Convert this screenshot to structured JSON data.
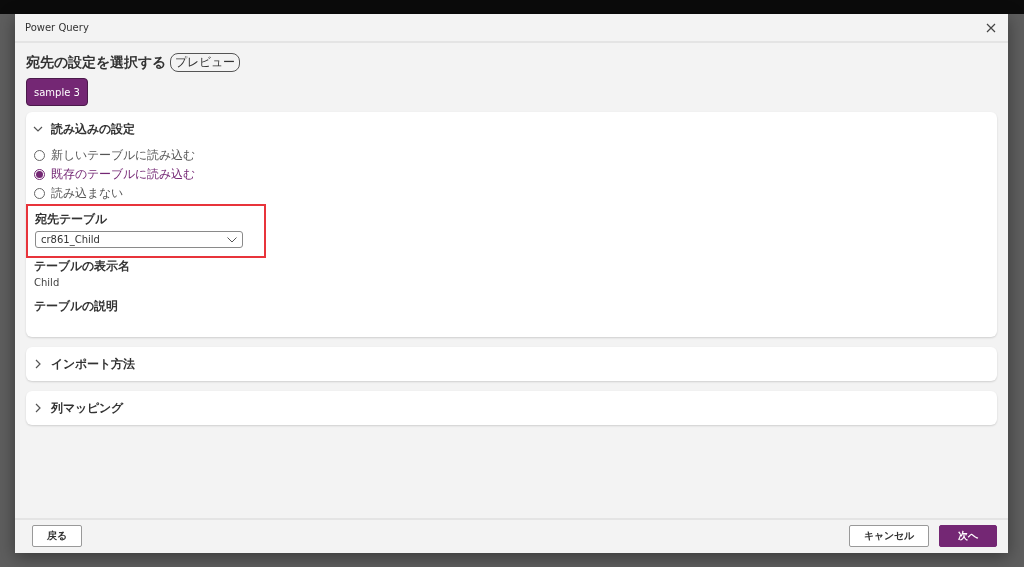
{
  "window": {
    "title": "Power Query"
  },
  "heading": {
    "title": "宛先の設定を選択する",
    "badge": "プレビュー"
  },
  "query_tabs": [
    {
      "label": "sample 3",
      "selected": true
    }
  ],
  "sections": [
    {
      "title": "読み込みの設定",
      "expanded": true,
      "options": [
        {
          "label": "新しいテーブルに読み込む",
          "selected": false
        },
        {
          "label": "既存のテーブルに読み込む",
          "selected": true
        },
        {
          "label": "読み込まない",
          "selected": false
        }
      ],
      "destination_table": {
        "label": "宛先テーブル",
        "value": "cr861_Child",
        "highlighted": true
      },
      "display_name": {
        "label": "テーブルの表示名",
        "value": "Child"
      },
      "description": {
        "label": "テーブルの説明"
      }
    },
    {
      "title": "インポート方法",
      "expanded": false
    },
    {
      "title": "列マッピング",
      "expanded": false
    }
  ],
  "footer": {
    "back": "戻る",
    "cancel": "キャンセル",
    "next": "次へ"
  }
}
